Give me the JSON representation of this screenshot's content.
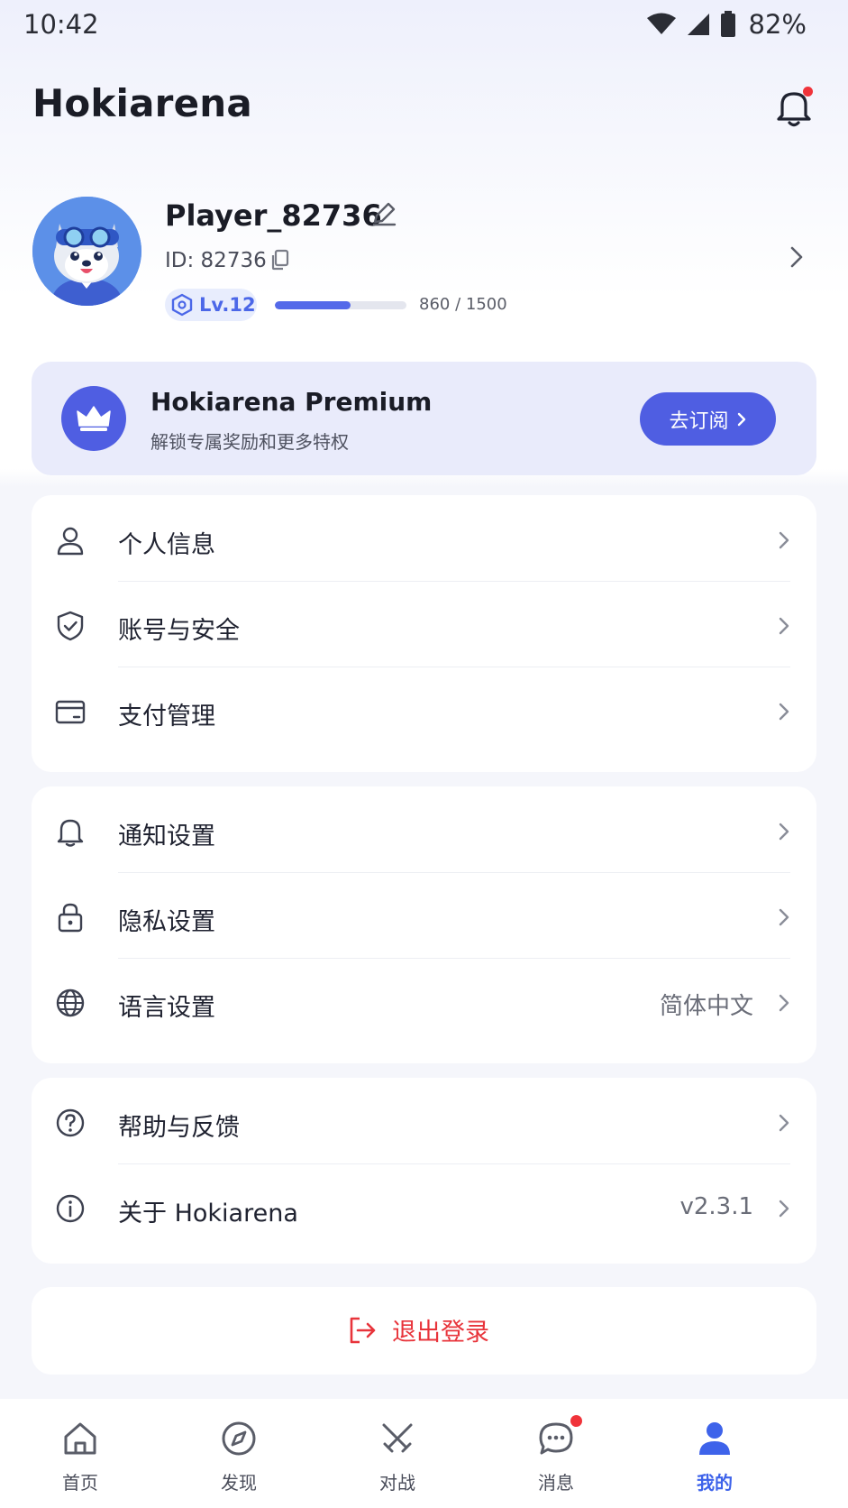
{
  "status_bar": {
    "time": "10:42",
    "battery": "82%"
  },
  "header": {
    "title": "Hokiarena"
  },
  "profile": {
    "name": "Player_82736",
    "id_text": "ID: 82736",
    "level": "Lv.12",
    "xp_text": "860 / 1500",
    "xp_fraction": 0.573
  },
  "premium": {
    "title": "Hokiarena Premium",
    "subtitle": "解锁专属奖励和更多特权",
    "button": "去订阅"
  },
  "menu_groups": [
    {
      "items": [
        {
          "label": "个人信息",
          "icon": "user-icon"
        },
        {
          "label": "账号与安全",
          "icon": "shield-icon"
        },
        {
          "label": "支付管理",
          "icon": "card-icon"
        }
      ]
    },
    {
      "items": [
        {
          "label": "通知设置",
          "icon": "bell-icon"
        },
        {
          "label": "隐私设置",
          "icon": "lock-icon"
        },
        {
          "label": "语言设置",
          "icon": "globe-icon",
          "value": "简体中文"
        }
      ]
    },
    {
      "items": [
        {
          "label": "帮助与反馈",
          "icon": "help-icon"
        },
        {
          "label": "关于 Hokiarena",
          "icon": "info-icon",
          "value": "v2.3.1"
        }
      ]
    }
  ],
  "logout": {
    "label": "退出登录"
  },
  "bottom_nav": [
    {
      "label": "首页",
      "icon": "home-icon"
    },
    {
      "label": "发现",
      "icon": "compass-icon"
    },
    {
      "label": "对战",
      "icon": "swords-icon"
    },
    {
      "label": "消息",
      "icon": "chat-icon",
      "badge": true
    },
    {
      "label": "我的",
      "icon": "profile-icon",
      "active": true
    }
  ],
  "colors": {
    "accent": "#4f5ee2",
    "active_nav": "#3e63ea",
    "danger": "#e8343b",
    "notification_dot": "#f0333a"
  }
}
